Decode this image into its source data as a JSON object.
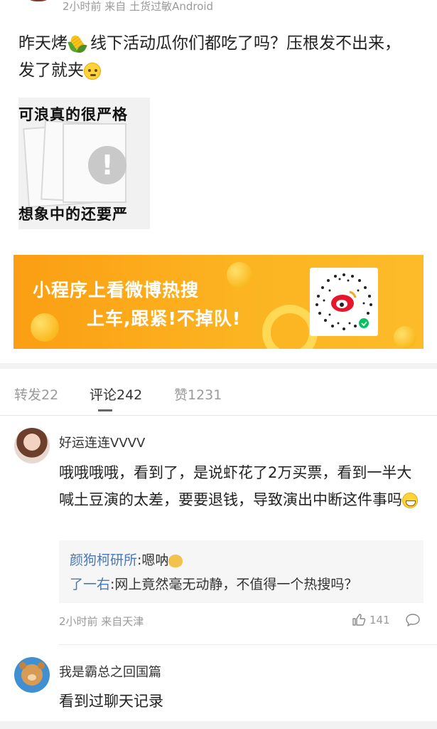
{
  "post": {
    "meta": "2小时前 来自 土货过敏Android",
    "text_part1": "昨天烤",
    "text_part2": "线下活动瓜你们都吃了吗？压根发不出来，发了就夹",
    "image": {
      "top_text": "可浪真的很严格",
      "bottom_text": "想象中的还要严"
    }
  },
  "banner": {
    "line1": "小程序上看微博热搜",
    "line2": "上车,跟紧!不掉队!"
  },
  "tabs": [
    {
      "label": "转发22"
    },
    {
      "label": "评论242"
    },
    {
      "label": "赞1231"
    }
  ],
  "comments": [
    {
      "user": "好运连连VVVV",
      "text": "哦哦哦哦，看到了，是说虾花了2万买票，看到一半大喊土豆演的太差，要要退钱，导致演出中断这件事吗",
      "replies": [
        {
          "name": "颜狗柯研所",
          "text": ":嗯呐"
        },
        {
          "name": "了一右",
          "text": ":网上竟然毫无动静，不值得一个热搜吗？"
        }
      ],
      "meta": "2小时前 来自天津",
      "likes": "141"
    },
    {
      "user": "我是霸总之回国篇",
      "text": "看到过聊天记录"
    }
  ],
  "icons": {
    "like": "thumbs-up-icon",
    "comment": "comment-bubble-icon",
    "corn": "corn-emoji",
    "think": "thinking-emoji",
    "grin": "grin-emoji",
    "cat": "cat-emoji"
  },
  "colors": {
    "banner": "#fcb421",
    "reply_name": "#4b78b5",
    "meta_gray": "#9a9a9a"
  }
}
